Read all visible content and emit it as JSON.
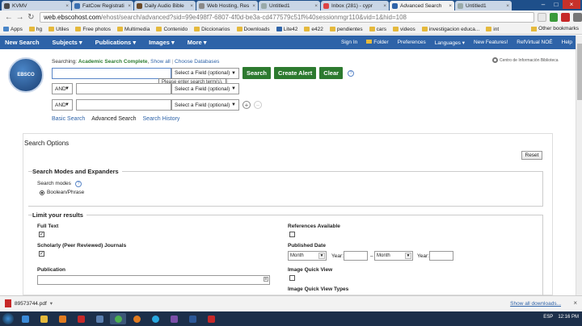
{
  "browser": {
    "tabs": [
      {
        "label": "KVMV",
        "color": "#4a4a4a"
      },
      {
        "label": "FatCow Registrati",
        "color": "#3a6fb0"
      },
      {
        "label": "Daily Audio Bible",
        "color": "#6b4b2b"
      },
      {
        "label": "Web Hosting, Res",
        "color": "#8a8a8a"
      },
      {
        "label": "Untitled1",
        "color": "#9aa"
      },
      {
        "label": "Inbox (281) - cypr",
        "color": "#d44"
      },
      {
        "label": "Advanced Search",
        "color": "#2e63a8"
      },
      {
        "label": "Untitled1",
        "color": "#9aa"
      }
    ],
    "url_host": "web.ebscohost.com",
    "url_path": "/ehost/search/advanced?sid=99e498f7-6807-4f0d-be3a-cd477579c51f%40sessionmgr110&vid=1&hid=108",
    "bookmarks": [
      "Apps",
      "hg",
      "Utiles",
      "Free photos",
      "Multimedia",
      "Contenido",
      "Diccionarios",
      "Downloads",
      "Lite42",
      "e422",
      "pendientes",
      "cars",
      "videos",
      "investigacion educa...",
      "int"
    ],
    "other_bookmarks": "Other bookmarks"
  },
  "topnav": {
    "left": [
      "New Search",
      "Subjects ▾",
      "Publications ▾",
      "Images ▾",
      "More ▾"
    ],
    "right": [
      "Sign In",
      "Folder",
      "Preferences",
      "Languages ▾",
      "New Features!",
      "RefVirtual NOÉ",
      "Help"
    ]
  },
  "logo_text": "EBSCO",
  "searching": {
    "prefix": "Searching: ",
    "db": "Academic Search Complete",
    "show_all": "Show all",
    "choose": "Choose Databases"
  },
  "org_label": "Centro de Información Biblioteca",
  "search": {
    "field_select": "Select a Field (optional)",
    "bool": "AND",
    "tooltip": "Please enter search term(s).",
    "search_btn": "Search",
    "alert_btn": "Create Alert",
    "clear_btn": "Clear",
    "help": "?",
    "add": "+",
    "remove": "−"
  },
  "links": {
    "basic": "Basic Search",
    "advanced": "Advanced Search",
    "history": "Search History"
  },
  "options": {
    "title": "Search Options",
    "reset": "Reset",
    "modes_legend": "Search Modes and Expanders",
    "modes_label": "Search modes",
    "mode_boolean": "Boolean/Phrase",
    "limit_legend": "Limit your results",
    "full_text": "Full Text",
    "scholarly": "Scholarly (Peer Reviewed) Journals",
    "publication": "Publication",
    "references": "References Available",
    "published_date": "Published Date",
    "month": "Month",
    "year": "Year:",
    "dash": "–",
    "iqv": "Image Quick View",
    "iqv_types": "Image Quick View Types"
  },
  "download": {
    "file": "89573744.pdf",
    "show_all": "Show all downloads...",
    "close": "×"
  },
  "taskbar": {
    "lang": "ESP",
    "time": "12:16 PM"
  }
}
